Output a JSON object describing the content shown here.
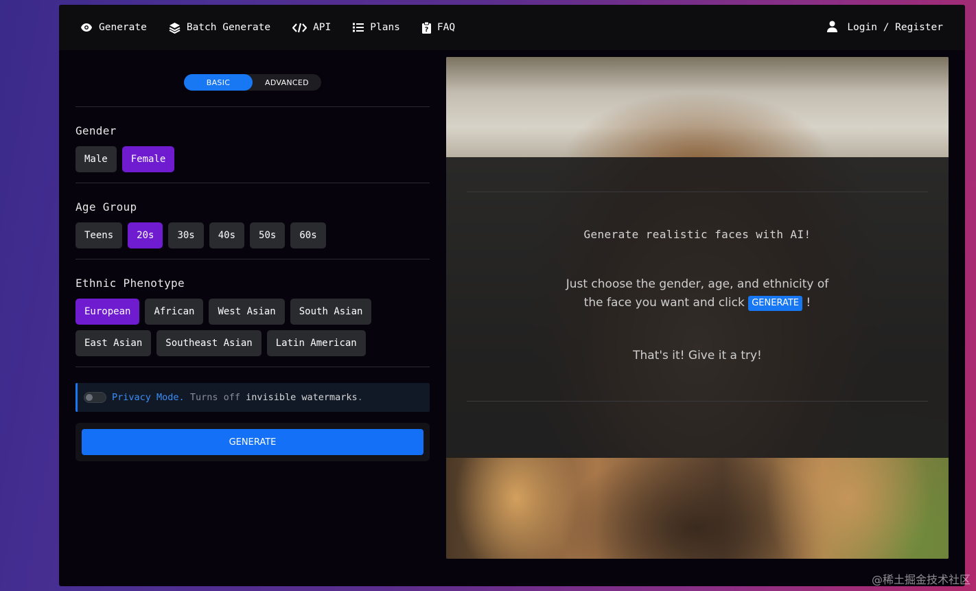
{
  "nav": {
    "items": [
      {
        "label": "Generate",
        "icon": "eye-icon"
      },
      {
        "label": "Batch Generate",
        "icon": "layers-icon"
      },
      {
        "label": "API",
        "icon": "code-icon"
      },
      {
        "label": "Plans",
        "icon": "list-icon"
      },
      {
        "label": "FAQ",
        "icon": "clipboard-question-icon"
      }
    ],
    "login": {
      "label": "Login / Register",
      "icon": "user-icon"
    }
  },
  "mode_toggle": {
    "basic": "BASIC",
    "advanced": "ADVANCED",
    "active": "BASIC"
  },
  "gender": {
    "title": "Gender",
    "options": [
      "Male",
      "Female"
    ],
    "selected": "Female"
  },
  "age": {
    "title": "Age Group",
    "options": [
      "Teens",
      "20s",
      "30s",
      "40s",
      "50s",
      "60s"
    ],
    "selected": "20s"
  },
  "ethnic": {
    "title": "Ethnic Phenotype",
    "row1": [
      "European",
      "African",
      "West Asian",
      "South Asian"
    ],
    "row2": [
      "East Asian",
      "Southeast Asian",
      "Latin American"
    ],
    "selected": "European"
  },
  "privacy": {
    "link": "Privacy Mode.",
    "text1": "Turns off",
    "strong": "invisible watermarks",
    "text2": "."
  },
  "generate_button": "GENERATE",
  "overlay": {
    "title": "Generate realistic faces with AI!",
    "line1": "Just choose the gender, age, and ethnicity of",
    "line2_pre": "the face you want and click",
    "badge": "GENERATE",
    "line2_post": "!",
    "line3": "That's it! Give it a try!"
  },
  "watermark": "@稀土掘金技术社区",
  "colors": {
    "accent_blue": "#1877f2",
    "selected_purple": "#6f1bd0",
    "panel_bg": "#06030c"
  }
}
